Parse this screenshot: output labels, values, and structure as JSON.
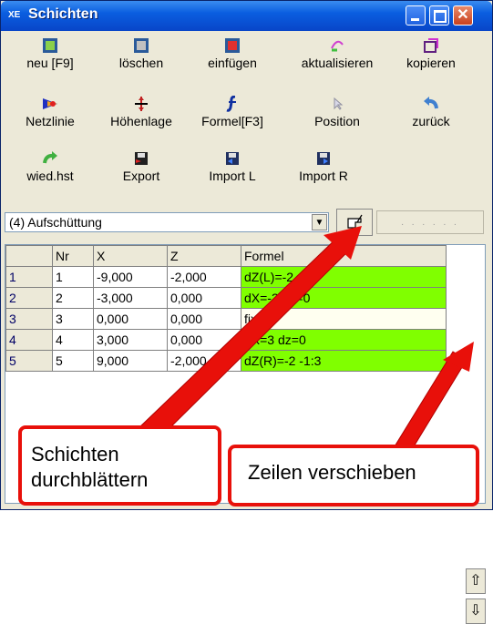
{
  "window": {
    "title": "Schichten",
    "title_icon": "XE"
  },
  "toolbar": {
    "row1": [
      {
        "label": "neu [F9]",
        "icon": "new-layer-icon"
      },
      {
        "label": "löschen",
        "icon": "delete-layer-icon"
      },
      {
        "label": "einfügen",
        "icon": "insert-layer-icon"
      },
      {
        "label": "aktualisieren",
        "icon": "refresh-icon"
      },
      {
        "label": "kopieren",
        "icon": "copy-icon"
      }
    ],
    "row2": [
      {
        "label": "Netzlinie",
        "icon": "netline-icon"
      },
      {
        "label": "Höhenlage",
        "icon": "height-icon"
      },
      {
        "label": "Formel[F3]",
        "icon": "formula-icon"
      },
      {
        "label": "Position",
        "icon": "cursor-icon"
      },
      {
        "label": "zurück",
        "icon": "undo-icon"
      }
    ],
    "row3": [
      {
        "label": "wied.hst",
        "icon": "redo-icon"
      },
      {
        "label": "Export",
        "icon": "export-icon"
      },
      {
        "label": "Import L",
        "icon": "import-l-icon"
      },
      {
        "label": "Import R",
        "icon": "import-r-icon"
      }
    ]
  },
  "combo": {
    "value": "(4) Aufschüttung"
  },
  "dotted_button": {
    "label": ". . . . . ."
  },
  "grid": {
    "headers": [
      "",
      "Nr",
      "X",
      "Z",
      "Formel"
    ],
    "rows": [
      {
        "row": "1",
        "nr": "1",
        "x": "-9,000",
        "z": "-2,000",
        "formel": "dZ(L)=-2 -1:3",
        "green": true
      },
      {
        "row": "2",
        "nr": "2",
        "x": "-3,000",
        "z": "0,000",
        "formel": "dX=-3 dz=0",
        "green": true
      },
      {
        "row": "3",
        "nr": "3",
        "x": "0,000",
        "z": "0,000",
        "formel": "fix",
        "green": false
      },
      {
        "row": "4",
        "nr": "4",
        "x": "3,000",
        "z": "0,000",
        "formel": "dX=3 dz=0",
        "green": true
      },
      {
        "row": "5",
        "nr": "5",
        "x": "9,000",
        "z": "-2,000",
        "formel": "dZ(R)=-2 -1:3",
        "green": true
      }
    ]
  },
  "callouts": {
    "left_line1": "Schichten",
    "left_line2": "durchblättern",
    "right": "Zeilen verschieben"
  },
  "colors": {
    "title_blue": "#0a5ee0",
    "green_cell": "#80ff00",
    "callout_red": "#e8100a"
  }
}
